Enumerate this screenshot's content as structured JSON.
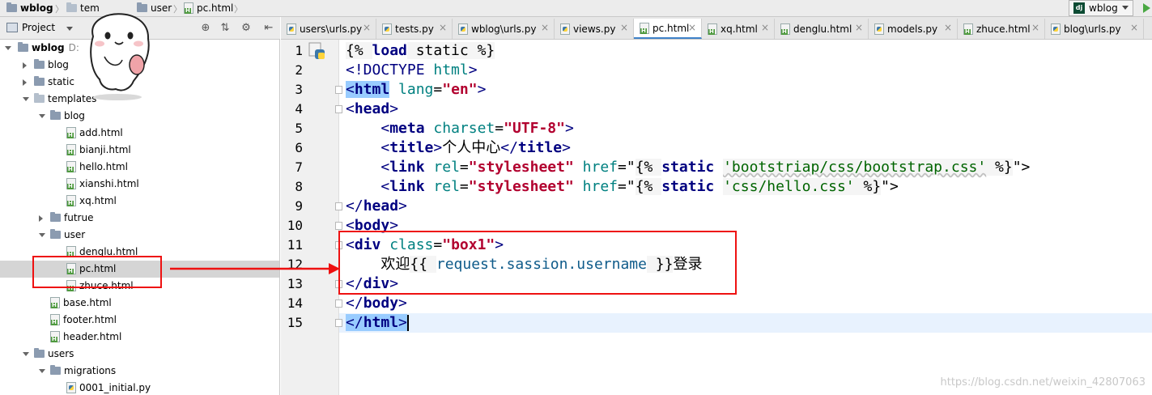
{
  "breadcrumb": {
    "project": "wblog",
    "templates_partial": "tem",
    "user": "user",
    "file": "pc.html"
  },
  "run_config": {
    "label": "wblog"
  },
  "project_panel": {
    "title": "Project",
    "root_name": "wblog",
    "root_path_partial": "D:",
    "tree": [
      {
        "label": "blog",
        "kind": "folder",
        "indent": 1,
        "expanded": false
      },
      {
        "label": "static",
        "kind": "folder",
        "indent": 1,
        "expanded": false
      },
      {
        "label": "templates",
        "kind": "folder-light",
        "indent": 1,
        "expanded": true
      },
      {
        "label": "blog",
        "kind": "folder",
        "indent": 2,
        "expanded": true
      },
      {
        "label": "add.html",
        "kind": "html",
        "indent": 3
      },
      {
        "label": "bianji.html",
        "kind": "html",
        "indent": 3
      },
      {
        "label": "hello.html",
        "kind": "html",
        "indent": 3
      },
      {
        "label": "xianshi.html",
        "kind": "html",
        "indent": 3
      },
      {
        "label": "xq.html",
        "kind": "html",
        "indent": 3
      },
      {
        "label": "futrue",
        "kind": "folder",
        "indent": 2,
        "expanded": false
      },
      {
        "label": "user",
        "kind": "folder",
        "indent": 2,
        "expanded": true
      },
      {
        "label": "denglu.html",
        "kind": "html",
        "indent": 3
      },
      {
        "label": "pc.html",
        "kind": "html",
        "indent": 3,
        "selected": true
      },
      {
        "label": "zhuce.html",
        "kind": "html",
        "indent": 3
      },
      {
        "label": "base.html",
        "kind": "html",
        "indent": 2
      },
      {
        "label": "footer.html",
        "kind": "html",
        "indent": 2
      },
      {
        "label": "header.html",
        "kind": "html",
        "indent": 2
      },
      {
        "label": "users",
        "kind": "folder",
        "indent": 1,
        "expanded": true
      },
      {
        "label": "migrations",
        "kind": "folder",
        "indent": 2,
        "expanded": true
      },
      {
        "label": "0001_initial.py",
        "kind": "py",
        "indent": 3
      }
    ]
  },
  "tabs": [
    {
      "label": "users\\urls.py",
      "kind": "py"
    },
    {
      "label": "tests.py",
      "kind": "py"
    },
    {
      "label": "wblog\\urls.py",
      "kind": "py"
    },
    {
      "label": "views.py",
      "kind": "py"
    },
    {
      "label": "pc.html",
      "kind": "html",
      "active": true
    },
    {
      "label": "xq.html",
      "kind": "html"
    },
    {
      "label": "denglu.html",
      "kind": "html"
    },
    {
      "label": "models.py",
      "kind": "py"
    },
    {
      "label": "zhuce.html",
      "kind": "html"
    },
    {
      "label": "blog\\urls.py",
      "kind": "py"
    }
  ],
  "editor": {
    "line_numbers": [
      "1",
      "2",
      "3",
      "4",
      "5",
      "6",
      "7",
      "8",
      "9",
      "10",
      "11",
      "12",
      "13",
      "14",
      "15"
    ],
    "lines": [
      [
        [
          "tpl",
          "{% "
        ],
        [
          "kw",
          "load"
        ],
        [
          "tpl",
          " static %}"
        ]
      ],
      [
        [
          "tag",
          "<!DOCTYPE "
        ],
        [
          "attr",
          "html"
        ],
        [
          "tag",
          ">"
        ]
      ],
      [
        [
          "hl",
          "<"
        ],
        [
          "hl-b",
          "html"
        ],
        [
          "plain",
          " "
        ],
        [
          "attr",
          "lang"
        ],
        [
          "plain",
          "="
        ],
        [
          "str",
          "\"en\""
        ],
        [
          "tag",
          ">"
        ]
      ],
      [
        [
          "tag",
          "<"
        ],
        [
          "tagb",
          "head"
        ],
        [
          "tag",
          ">"
        ]
      ],
      [
        [
          "plain",
          "    "
        ],
        [
          "tag",
          "<"
        ],
        [
          "tagb",
          "meta"
        ],
        [
          "plain",
          " "
        ],
        [
          "attr",
          "charset"
        ],
        [
          "plain",
          "="
        ],
        [
          "str",
          "\"UTF-8\""
        ],
        [
          "tag",
          ">"
        ]
      ],
      [
        [
          "plain",
          "    "
        ],
        [
          "tag",
          "<"
        ],
        [
          "tagb",
          "title"
        ],
        [
          "tag",
          ">"
        ],
        [
          "plain",
          "个人中心"
        ],
        [
          "tag",
          "</"
        ],
        [
          "tagb",
          "title"
        ],
        [
          "tag",
          ">"
        ]
      ],
      [
        [
          "plain",
          "    "
        ],
        [
          "tag",
          "<"
        ],
        [
          "tagb",
          "link"
        ],
        [
          "plain",
          " "
        ],
        [
          "attr",
          "rel"
        ],
        [
          "plain",
          "="
        ],
        [
          "str",
          "\"stylesheet\""
        ],
        [
          "plain",
          " "
        ],
        [
          "attr",
          "href"
        ],
        [
          "plain",
          "=\""
        ],
        [
          "tpl",
          "{% "
        ],
        [
          "kw",
          "static"
        ],
        [
          "plain",
          " "
        ],
        [
          "str-sq",
          "'bootstriap/css/bootstrap.css'"
        ],
        [
          "tpl",
          " %}"
        ],
        [
          "plain",
          "\">"
        ]
      ],
      [
        [
          "plain",
          "    "
        ],
        [
          "tag",
          "<"
        ],
        [
          "tagb",
          "link"
        ],
        [
          "plain",
          " "
        ],
        [
          "attr",
          "rel"
        ],
        [
          "plain",
          "="
        ],
        [
          "str",
          "\"stylesheet\""
        ],
        [
          "plain",
          " "
        ],
        [
          "attr",
          "href"
        ],
        [
          "plain",
          "=\""
        ],
        [
          "tpl",
          "{% "
        ],
        [
          "kw",
          "static"
        ],
        [
          "plain",
          " "
        ],
        [
          "str-s",
          "'css/hello.css'"
        ],
        [
          "tpl",
          " %}"
        ],
        [
          "plain",
          "\">"
        ]
      ],
      [
        [
          "tag",
          "</"
        ],
        [
          "tagb",
          "head"
        ],
        [
          "tag",
          ">"
        ]
      ],
      [
        [
          "tag",
          "<"
        ],
        [
          "tagb",
          "body"
        ],
        [
          "tag",
          ">"
        ]
      ],
      [
        [
          "tag",
          "<"
        ],
        [
          "tagb",
          "div"
        ],
        [
          "plain",
          " "
        ],
        [
          "attr",
          "class"
        ],
        [
          "plain",
          "="
        ],
        [
          "str",
          "\"box1\""
        ],
        [
          "tag",
          ">"
        ]
      ],
      [
        [
          "plain",
          "    欢迎"
        ],
        [
          "tpl",
          "{{ "
        ],
        [
          "var",
          "request.sassion.username"
        ],
        [
          "tpl",
          " }}"
        ],
        [
          "plain",
          "登录"
        ]
      ],
      [
        [
          "tag",
          "</"
        ],
        [
          "tagb",
          "div"
        ],
        [
          "tag",
          ">"
        ]
      ],
      [
        [
          "tag",
          "</"
        ],
        [
          "tagb",
          "body"
        ],
        [
          "tag",
          ">"
        ]
      ],
      [
        [
          "hl",
          "</"
        ],
        [
          "hl-b",
          "html"
        ],
        [
          "hl",
          ">"
        ],
        [
          "caret",
          ""
        ]
      ]
    ]
  },
  "watermark": "https://blog.csdn.net/weixin_42807063"
}
